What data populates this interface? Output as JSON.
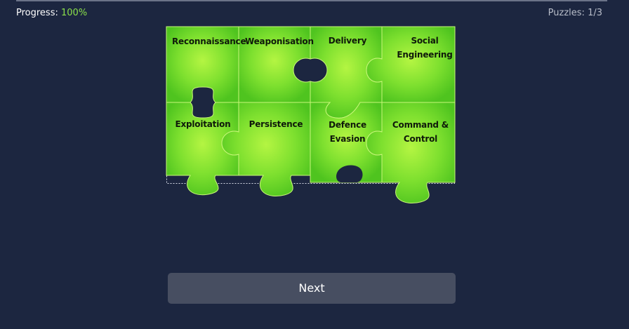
{
  "header": {
    "progress_label": "Progress:",
    "progress_value": "100%",
    "puzzle_counter": "Puzzles: 1/3"
  },
  "puzzle": {
    "pieces": [
      {
        "label": "Reconnaissance"
      },
      {
        "label": "Weaponisation"
      },
      {
        "label": "Delivery"
      },
      {
        "label": "Social",
        "label2": "Engineering"
      },
      {
        "label": "Exploitation"
      },
      {
        "label": "Persistence"
      },
      {
        "label": "Defence",
        "label2": "Evasion"
      },
      {
        "label": "Command &",
        "label2": "Control"
      }
    ],
    "colors": {
      "piece_light": "#b4f542",
      "piece_mid": "#7ee02f",
      "piece_dark": "#4fc41f",
      "seam": "#c9f77a"
    }
  },
  "actions": {
    "next_label": "Next"
  }
}
